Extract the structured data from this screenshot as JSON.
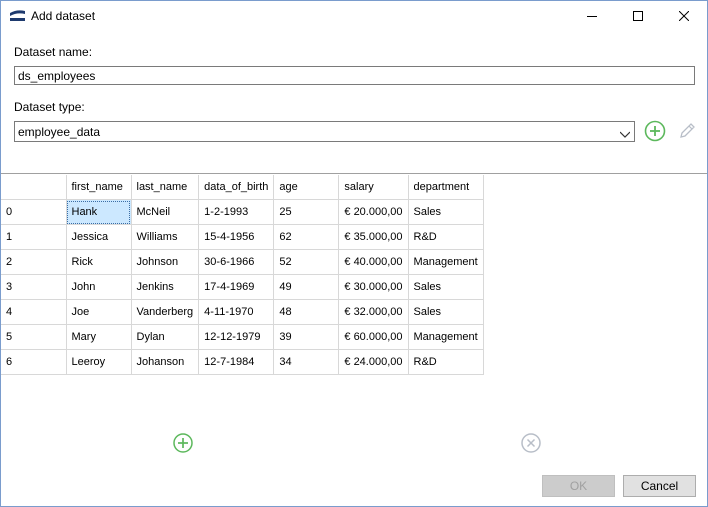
{
  "window": {
    "title": "Add dataset",
    "controls": {
      "minimize": "minimize",
      "maximize": "maximize",
      "close": "close"
    }
  },
  "form": {
    "name_label": "Dataset name:",
    "name_value": "ds_employees",
    "type_label": "Dataset type:",
    "type_value": "employee_data"
  },
  "grid": {
    "columns": [
      "first_name",
      "last_name",
      "data_of_birth",
      "age",
      "salary",
      "department"
    ],
    "rows": [
      {
        "index": "0",
        "cells": [
          "Hank",
          "McNeil",
          "1-2-1993",
          "25",
          "€ 20.000,00",
          "Sales"
        ]
      },
      {
        "index": "1",
        "cells": [
          "Jessica",
          "Williams",
          "15-4-1956",
          "62",
          "€ 35.000,00",
          "R&D"
        ]
      },
      {
        "index": "2",
        "cells": [
          "Rick",
          "Johnson",
          "30-6-1966",
          "52",
          "€ 40.000,00",
          "Management"
        ]
      },
      {
        "index": "3",
        "cells": [
          "John",
          "Jenkins",
          "17-4-1969",
          "49",
          "€ 30.000,00",
          "Sales"
        ]
      },
      {
        "index": "4",
        "cells": [
          "Joe",
          "Vanderberg",
          "4-11-1970",
          "48",
          "€ 32.000,00",
          "Sales"
        ]
      },
      {
        "index": "5",
        "cells": [
          "Mary",
          "Dylan",
          "12-12-1979",
          "39",
          "€ 60.000,00",
          "Management"
        ]
      },
      {
        "index": "6",
        "cells": [
          "Leeroy",
          "Johanson",
          "12-7-1984",
          "34",
          "€ 24.000,00",
          "R&D"
        ]
      }
    ]
  },
  "buttons": {
    "ok": "OK",
    "cancel": "Cancel"
  },
  "colors": {
    "accent_green": "#5cb85c",
    "selection": "#cce8ff",
    "disabled_gray": "#b8bec8",
    "title_icon": "#1e3a6e"
  }
}
